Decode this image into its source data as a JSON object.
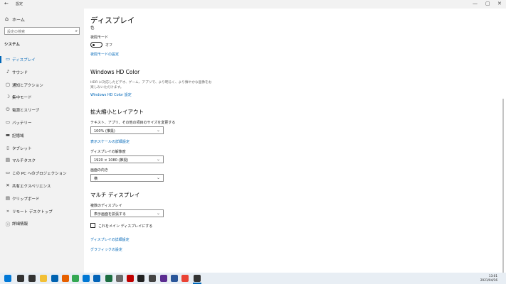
{
  "window": {
    "back_glyph": "←",
    "title": "設定",
    "minimize_glyph": "—",
    "maximize_glyph": "▢",
    "close_glyph": "✕"
  },
  "sidebar": {
    "home": {
      "icon": "home-icon",
      "glyph": "⌂",
      "label": "ホーム"
    },
    "search": {
      "placeholder": "設定の検索",
      "icon": "search-icon",
      "glyph": "⌕"
    },
    "section_label": "システム",
    "items": [
      {
        "icon": "display-icon",
        "glyph": "▭",
        "label": "ディスプレイ"
      },
      {
        "icon": "sound-icon",
        "glyph": "♪",
        "label": "サウンド"
      },
      {
        "icon": "notifications-icon",
        "glyph": "▢",
        "label": "通知とアクション"
      },
      {
        "icon": "focus-assist-icon",
        "glyph": "☽",
        "label": "集中モード"
      },
      {
        "icon": "power-sleep-icon",
        "glyph": "⏻",
        "label": "電源とスリープ"
      },
      {
        "icon": "battery-icon",
        "glyph": "▭",
        "label": "バッテリー"
      },
      {
        "icon": "storage-icon",
        "glyph": "▬",
        "label": "記憶域"
      },
      {
        "icon": "tablet-icon",
        "glyph": "▯",
        "label": "タブレット"
      },
      {
        "icon": "multitasking-icon",
        "glyph": "▤",
        "label": "マルチタスク"
      },
      {
        "icon": "projecting-icon",
        "glyph": "▭",
        "label": "この PC へのプロジェクション"
      },
      {
        "icon": "shared-experiences-icon",
        "glyph": "✕",
        "label": "共有エクスペリエンス"
      },
      {
        "icon": "clipboard-icon",
        "glyph": "▤",
        "label": "クリップボード"
      },
      {
        "icon": "remote-desktop-icon",
        "glyph": "»",
        "label": "リモート デスクトップ"
      },
      {
        "icon": "about-icon",
        "glyph": "ⓘ",
        "label": "詳細情報"
      }
    ],
    "active_index": 0
  },
  "main": {
    "title": "ディスプレイ",
    "subtitle": "色",
    "night_light": {
      "label": "夜間モード",
      "state": "オフ",
      "settings_link": "夜間モードの設定"
    },
    "hdr": {
      "heading": "Windows HD Color",
      "description": "HDR に対応したビデオ、ゲーム、アプリで、より明るく、より鮮やかな画像をお楽しみいただけます。",
      "link": "Windows HD Color 設定"
    },
    "scale_layout": {
      "heading": "拡大縮小とレイアウト",
      "scale_label": "テキスト、アプリ、その他の項目のサイズを変更する",
      "scale_value": "100% (推奨)",
      "advanced_scaling_link": "表示スケールの詳細設定",
      "resolution_label": "ディスプレイの解像度",
      "resolution_value": "1920 × 1080 (推奨)",
      "orientation_label": "画面の向き",
      "orientation_value": "横"
    },
    "multiple_displays": {
      "heading": "マルチ ディスプレイ",
      "label": "複数のディスプレイ",
      "value": "表示画面を拡張する",
      "main_display_checkbox": "これをメイン ディスプレイにする",
      "advanced_link": "ディスプレイの詳細設定",
      "graphics_link": "グラフィックの設定"
    },
    "chevron_glyph": "⌄"
  },
  "taskbar": {
    "apps": [
      {
        "icon": "start-icon",
        "color": "#0078d7"
      },
      {
        "icon": "search-icon",
        "color": "#333333"
      },
      {
        "icon": "task-view-icon",
        "color": "#333333"
      },
      {
        "icon": "file-explorer-icon",
        "color": "#f2c037"
      },
      {
        "icon": "store-icon",
        "color": "#0063b1"
      },
      {
        "icon": "firefox-icon",
        "color": "#e66000"
      },
      {
        "icon": "chrome-icon",
        "color": "#34a853"
      },
      {
        "icon": "mail-icon",
        "color": "#0078d4"
      },
      {
        "icon": "outlook-icon",
        "color": "#0364b8"
      },
      {
        "icon": "excel-icon",
        "color": "#1d6f42"
      },
      {
        "icon": "app-icon",
        "color": "#6b6b6b"
      },
      {
        "icon": "record-icon",
        "color": "#c00000"
      },
      {
        "icon": "media-icon",
        "color": "#222222"
      },
      {
        "icon": "calculator-icon",
        "color": "#444444"
      },
      {
        "icon": "onenote-icon",
        "color": "#5c2d91"
      },
      {
        "icon": "app-icon-2",
        "color": "#2b579a"
      },
      {
        "icon": "chrome-icon-2",
        "color": "#ea4335"
      },
      {
        "icon": "settings-icon",
        "color": "#333333"
      }
    ],
    "clock": {
      "time": "13:01",
      "date": "2021/04/16"
    }
  }
}
